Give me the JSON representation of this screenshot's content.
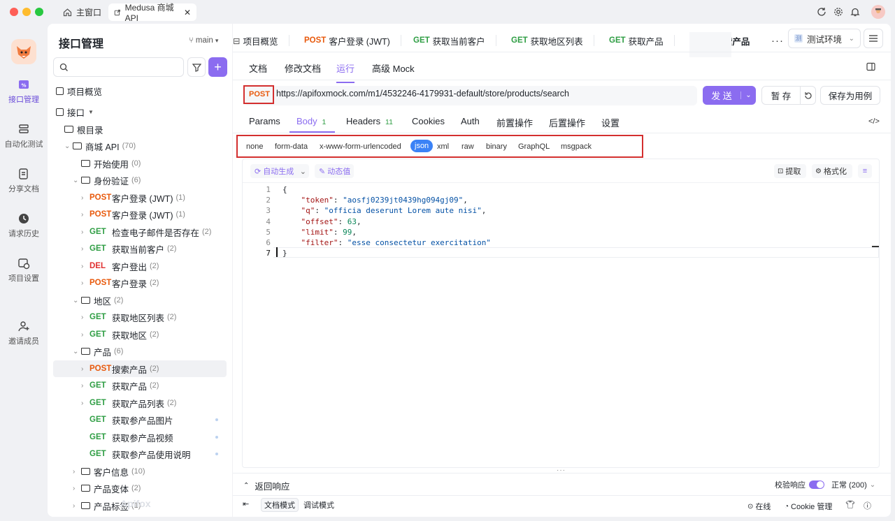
{
  "window_tabs": {
    "home": "主窗口",
    "project": "Medusa 商城 API"
  },
  "nav": [
    {
      "label": "接口管理"
    },
    {
      "label": "自动化测试"
    },
    {
      "label": "分享文档"
    },
    {
      "label": "请求历史"
    },
    {
      "label": "项目设置"
    },
    {
      "label": "邀请成员"
    }
  ],
  "sidebar": {
    "title": "接口管理",
    "branch": "main",
    "search_placeholder": "",
    "overview": "项目概览",
    "interfaces": "接口",
    "root": "根目录",
    "tree": [
      {
        "label": "商城 API",
        "count": "(70)"
      },
      {
        "label": "开始使用",
        "count": "(0)"
      },
      {
        "label": "身份验证",
        "count": "(6)"
      },
      {
        "method": "POST",
        "label": "客户登录 (JWT)",
        "count": "(1)"
      },
      {
        "method": "POST",
        "label": "客户登录 (JWT)",
        "count": "(1)"
      },
      {
        "method": "GET",
        "label": "检查电子邮件是否存在",
        "count": "(2)"
      },
      {
        "method": "GET",
        "label": "获取当前客户",
        "count": "(2)"
      },
      {
        "method": "DEL",
        "label": "客户登出",
        "count": "(2)"
      },
      {
        "method": "POST",
        "label": "客户登录",
        "count": "(2)"
      },
      {
        "label": "地区",
        "count": "(2)"
      },
      {
        "method": "GET",
        "label": "获取地区列表",
        "count": "(2)"
      },
      {
        "method": "GET",
        "label": "获取地区",
        "count": "(2)"
      },
      {
        "label": "产品",
        "count": "(6)"
      },
      {
        "method": "POST",
        "label": "搜索产品",
        "count": "(2)"
      },
      {
        "method": "GET",
        "label": "获取产品",
        "count": "(2)"
      },
      {
        "method": "GET",
        "label": "获取产品列表",
        "count": "(2)"
      },
      {
        "method": "GET",
        "label": "获取参产品图片",
        "count": ""
      },
      {
        "method": "GET",
        "label": "获取参产品视频",
        "count": ""
      },
      {
        "method": "GET",
        "label": "获取参产品使用说明",
        "count": ""
      },
      {
        "label": "客户信息",
        "count": "(10)"
      },
      {
        "label": "产品变体",
        "count": "(2)"
      },
      {
        "label": "产品标签",
        "count": "(1)"
      }
    ]
  },
  "req_tabs": [
    {
      "method": "",
      "label": "项目概览"
    },
    {
      "method": "POST",
      "label": "客户登录 (JWT)"
    },
    {
      "method": "GET",
      "label": "获取当前客户"
    },
    {
      "method": "GET",
      "label": "获取地区列表"
    },
    {
      "method": "GET",
      "label": "获取产品"
    },
    {
      "method": "POST",
      "label": "搜索产品"
    }
  ],
  "env": "测试环境",
  "doc_tabs": [
    "文档",
    "修改文档",
    "运行",
    "高级 Mock"
  ],
  "request": {
    "method": "POST",
    "url": "https://apifoxmock.com/m1/4532246-4179931-default/store/products/search",
    "send": "发 送",
    "save": "暂 存",
    "save_as": "保存为用例"
  },
  "body_tabs": [
    {
      "label": "Params",
      "count": ""
    },
    {
      "label": "Body",
      "count": "1"
    },
    {
      "label": "Headers",
      "count": "11"
    },
    {
      "label": "Cookies",
      "count": ""
    },
    {
      "label": "Auth",
      "count": ""
    },
    {
      "label": "前置操作",
      "count": ""
    },
    {
      "label": "后置操作",
      "count": ""
    },
    {
      "label": "设置",
      "count": ""
    }
  ],
  "payload_types": [
    "none",
    "form-data",
    "x-www-form-urlencoded",
    "json",
    "xml",
    "raw",
    "binary",
    "GraphQL",
    "msgpack"
  ],
  "editor_tools": {
    "auto": "自动生成",
    "dynamic": "动态值",
    "extract": "提取",
    "format": "格式化"
  },
  "code_lines": [
    "{",
    "    \"token\": \"aosfj0239jt0439hg094gj09\",",
    "    \"q\": \"officia deserunt Lorem aute nisi\",",
    "    \"offset\": 63,",
    "    \"limit\": 99,",
    "    \"filter\": \"esse consectetur exercitation\"",
    "}"
  ],
  "response": {
    "title": "返回响应",
    "validate": "校验响应",
    "status": "正常 (200)"
  },
  "footer": {
    "doc_mode": "文档模式",
    "debug_mode": "调试模式",
    "online": "在线",
    "cookie": "Cookie 管理",
    "watermark": "Apifox"
  },
  "colors": {
    "accent": "#8b6cf0",
    "post": "#e8590c",
    "get": "#2f9e44",
    "del": "#e03131"
  }
}
